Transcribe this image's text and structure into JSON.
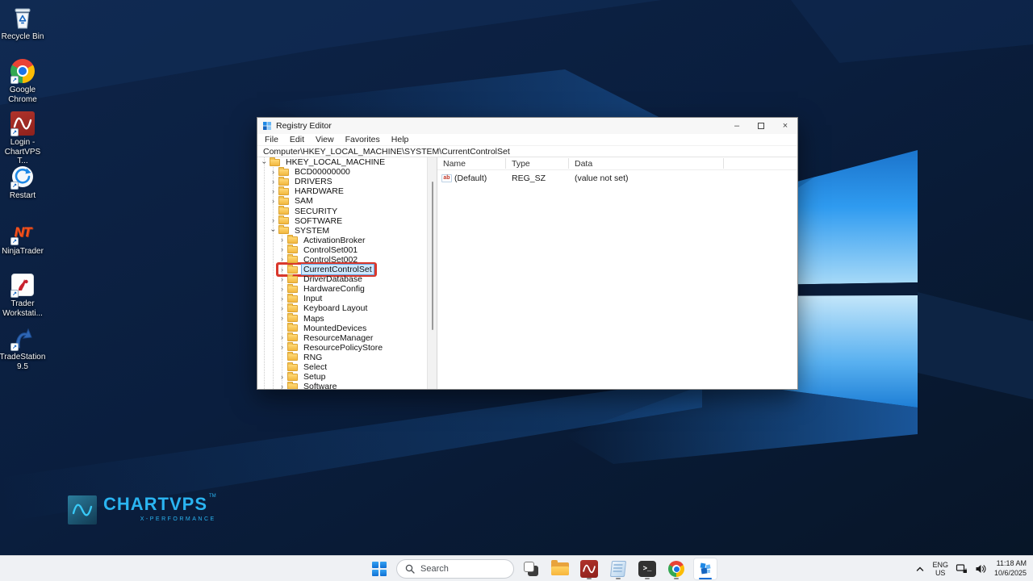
{
  "desktop": {
    "icons": [
      {
        "label": "Recycle Bin",
        "shortcut": false
      },
      {
        "label": "Google Chrome",
        "shortcut": true
      },
      {
        "label": "Login - ChartVPS T...",
        "shortcut": true
      },
      {
        "label": "Restart",
        "shortcut": true
      },
      {
        "label": "NinjaTrader",
        "shortcut": true
      },
      {
        "label": "Trader Workstati...",
        "shortcut": true
      },
      {
        "label": "TradeStation 9.5",
        "shortcut": true
      }
    ],
    "ninjatrader_monogram": "NT",
    "brand": {
      "title": "CHARTVPS",
      "tm": "TM",
      "subtitle": "X-PERFORMANCE"
    }
  },
  "window": {
    "title": "Registry Editor",
    "menu": [
      "File",
      "Edit",
      "View",
      "Favorites",
      "Help"
    ],
    "address": "Computer\\HKEY_LOCAL_MACHINE\\SYSTEM\\CurrentControlSet",
    "tree": [
      {
        "label": "HKEY_LOCAL_MACHINE",
        "level": 1,
        "chev": "expanded"
      },
      {
        "label": "BCD00000000",
        "level": 2,
        "chev": "collapsed"
      },
      {
        "label": "DRIVERS",
        "level": 2,
        "chev": "collapsed"
      },
      {
        "label": "HARDWARE",
        "level": 2,
        "chev": "collapsed"
      },
      {
        "label": "SAM",
        "level": 2,
        "chev": "collapsed"
      },
      {
        "label": "SECURITY",
        "level": 2,
        "chev": "none"
      },
      {
        "label": "SOFTWARE",
        "level": 2,
        "chev": "collapsed"
      },
      {
        "label": "SYSTEM",
        "level": 2,
        "chev": "expanded"
      },
      {
        "label": "ActivationBroker",
        "level": 3,
        "chev": "collapsed"
      },
      {
        "label": "ControlSet001",
        "level": 3,
        "chev": "collapsed"
      },
      {
        "label": "ControlSet002",
        "level": 3,
        "chev": "collapsed"
      },
      {
        "label": "CurrentControlSet",
        "level": 3,
        "chev": "collapsed",
        "selected": true,
        "annotated": true
      },
      {
        "label": "DriverDatabase",
        "level": 3,
        "chev": "collapsed"
      },
      {
        "label": "HardwareConfig",
        "level": 3,
        "chev": "collapsed"
      },
      {
        "label": "Input",
        "level": 3,
        "chev": "collapsed"
      },
      {
        "label": "Keyboard Layout",
        "level": 3,
        "chev": "collapsed"
      },
      {
        "label": "Maps",
        "level": 3,
        "chev": "collapsed"
      },
      {
        "label": "MountedDevices",
        "level": 3,
        "chev": "none"
      },
      {
        "label": "ResourceManager",
        "level": 3,
        "chev": "collapsed"
      },
      {
        "label": "ResourcePolicyStore",
        "level": 3,
        "chev": "collapsed"
      },
      {
        "label": "RNG",
        "level": 3,
        "chev": "none"
      },
      {
        "label": "Select",
        "level": 3,
        "chev": "none"
      },
      {
        "label": "Setup",
        "level": 3,
        "chev": "collapsed"
      },
      {
        "label": "Software",
        "level": 3,
        "chev": "collapsed"
      }
    ],
    "list": {
      "columns": [
        "Name",
        "Type",
        "Data"
      ],
      "rows": [
        {
          "name": "(Default)",
          "type": "REG_SZ",
          "data": "(value not set)"
        }
      ]
    }
  },
  "taskbar": {
    "search_placeholder": "Search",
    "items": [
      "start",
      "search",
      "task-view",
      "file-explorer",
      "chartvps",
      "notes",
      "terminal",
      "chrome",
      "registry-editor"
    ],
    "terminal_glyph": ">_",
    "tray": {
      "language_line1": "ENG",
      "language_line2": "US",
      "time": "11:18 AM",
      "date": "10/6/2025"
    }
  },
  "colors": {
    "brand_cyan": "#2ab4f1",
    "annotation_red": "#d9382c",
    "selection_blue": "#cde8ff",
    "taskbar_active_blue": "#0a6cd6",
    "wallpaper_navy": "#0a1c38",
    "folder_yellow": "#f2b83f"
  }
}
